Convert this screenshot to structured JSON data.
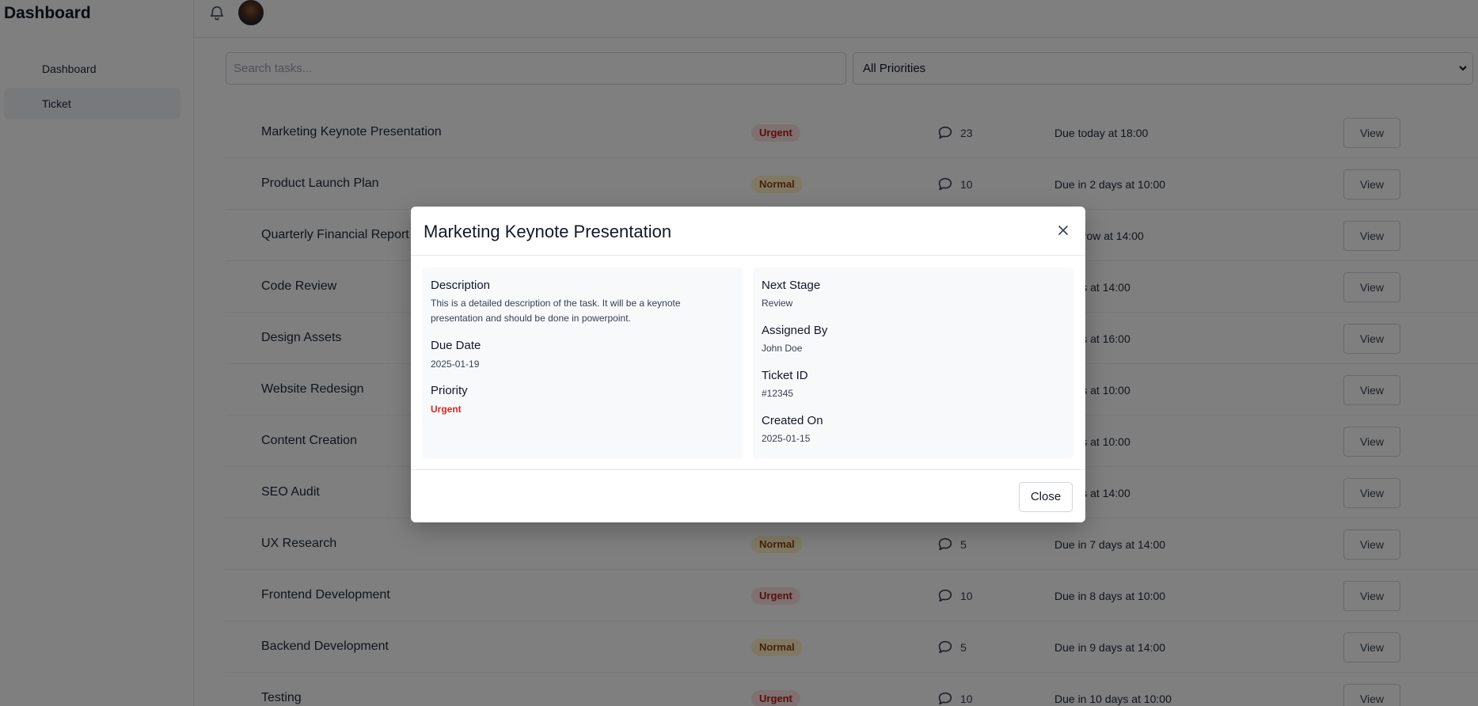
{
  "sidebar": {
    "brand": "Dashboard",
    "items": [
      {
        "label": "Dashboard",
        "active": false
      },
      {
        "label": "Ticket",
        "active": true
      }
    ]
  },
  "topbar": {
    "bell_icon": "bell-icon",
    "avatar": "user-avatar"
  },
  "filters": {
    "search_placeholder": "Search tasks...",
    "priority_selected": "All Priorities"
  },
  "tasks": [
    {
      "title": "Marketing Keynote Presentation",
      "priority": "Urgent",
      "comments": "23",
      "due": "Due today at 18:00",
      "action": "View"
    },
    {
      "title": "Product Launch Plan",
      "priority": "Normal",
      "comments": "10",
      "due": "Due in 2 days at 10:00",
      "action": "View"
    },
    {
      "title": "Quarterly Financial Report",
      "priority": "",
      "comments": "",
      "due": "tomorrow at 14:00",
      "action": "View"
    },
    {
      "title": "Code Review",
      "priority": "",
      "comments": "",
      "due": "2 days at 14:00",
      "action": "View"
    },
    {
      "title": "Design Assets",
      "priority": "",
      "comments": "",
      "due": "3 days at 16:00",
      "action": "View"
    },
    {
      "title": "Website Redesign",
      "priority": "",
      "comments": "",
      "due": "4 days at 10:00",
      "action": "View"
    },
    {
      "title": "Content Creation",
      "priority": "",
      "comments": "",
      "due": "5 days at 10:00",
      "action": "View"
    },
    {
      "title": "SEO Audit",
      "priority": "",
      "comments": "",
      "due": "6 days at 14:00",
      "action": "View"
    },
    {
      "title": "UX Research",
      "priority": "Normal",
      "comments": "5",
      "due": "Due in 7 days at 14:00",
      "action": "View"
    },
    {
      "title": "Frontend Development",
      "priority": "Urgent",
      "comments": "10",
      "due": "Due in 8 days at 10:00",
      "action": "View"
    },
    {
      "title": "Backend Development",
      "priority": "Normal",
      "comments": "5",
      "due": "Due in 9 days at 14:00",
      "action": "View"
    },
    {
      "title": "Testing",
      "priority": "Urgent",
      "comments": "10",
      "due": "Due in 10 days at 10:00",
      "action": "View"
    }
  ],
  "modal": {
    "title": "Marketing Keynote Presentation",
    "left": [
      {
        "label": "Description",
        "value": "This is a detailed description of the task. It will be a keynote presentation and should be done in powerpoint."
      },
      {
        "label": "Due Date",
        "value": "2025-01-19"
      },
      {
        "label": "Priority",
        "value": "Urgent"
      }
    ],
    "right": [
      {
        "label": "Next Stage",
        "value": "Review"
      },
      {
        "label": "Assigned By",
        "value": "John Doe"
      },
      {
        "label": "Ticket ID",
        "value": "#12345"
      },
      {
        "label": "Created On",
        "value": "2025-01-15"
      }
    ],
    "close_label": "Close"
  },
  "colors": {
    "urgent_text": "#b91c1c",
    "urgent_bg": "#fee2e2",
    "normal_text": "#92400e",
    "normal_bg": "#fef3c7",
    "overlay": "rgba(0,0,0,0.5)"
  }
}
